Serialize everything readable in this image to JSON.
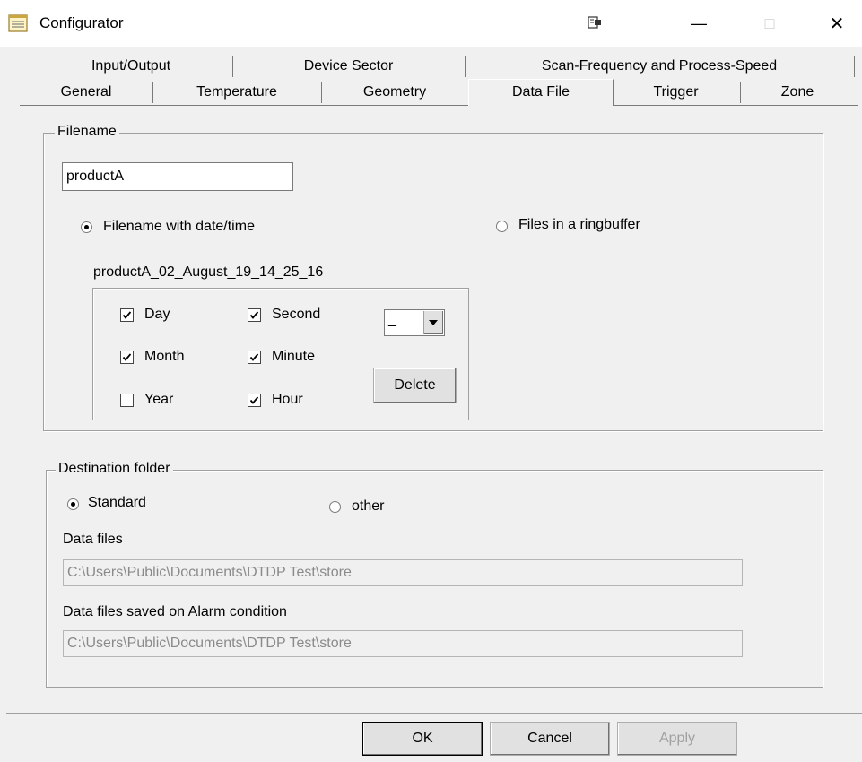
{
  "window": {
    "title": "Configurator",
    "minimize_glyph": "—",
    "maximize_glyph": "□",
    "close_glyph": "✕"
  },
  "tabs": {
    "row1": [
      "Input/Output",
      "Device Sector",
      "Scan-Frequency and Process-Speed"
    ],
    "row2": [
      "General",
      "Temperature",
      "Geometry",
      "Data File",
      "Trigger",
      "Zone"
    ],
    "active": "Data File"
  },
  "filename_group": {
    "legend": "Filename",
    "filename_value": "productA",
    "radio_datetime_label": "Filename with date/time",
    "radio_datetime_checked": true,
    "radio_ringbuffer_label": "Files in a ringbuffer",
    "radio_ringbuffer_checked": false,
    "preview": "productA_02_August_19_14_25_16",
    "checkboxes": {
      "day": {
        "label": "Day",
        "checked": true
      },
      "month": {
        "label": "Month",
        "checked": true
      },
      "year": {
        "label": "Year",
        "checked": false
      },
      "second": {
        "label": "Second",
        "checked": true
      },
      "minute": {
        "label": "Minute",
        "checked": true
      },
      "hour": {
        "label": "Hour",
        "checked": true
      }
    },
    "separator_value": "_",
    "delete_label": "Delete"
  },
  "destination_group": {
    "legend": "Destination folder",
    "radio_standard_label": "Standard",
    "radio_standard_checked": true,
    "radio_other_label": "other",
    "radio_other_checked": false,
    "data_files_label": "Data files",
    "data_files_path": "C:\\Users\\Public\\Documents\\DTDP Test\\store",
    "alarm_label": "Data files saved on Alarm condition",
    "alarm_path": "C:\\Users\\Public\\Documents\\DTDP Test\\store"
  },
  "buttons": {
    "ok": "OK",
    "cancel": "Cancel",
    "apply": "Apply"
  },
  "icons": {
    "app": "notepad-icon",
    "pin": "pin-icon",
    "combo": "dropdown-arrow-icon"
  }
}
